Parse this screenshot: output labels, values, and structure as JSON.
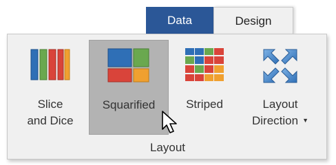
{
  "tabs": {
    "data": "Data",
    "design": "Design"
  },
  "ribbon": {
    "group_label": "Layout",
    "buttons": {
      "slice_line1": "Slice",
      "slice_line2": "and Dice",
      "squarified": "Squarified",
      "striped": "Striped",
      "direction_line1": "Layout",
      "direction_line2": "Direction",
      "direction_arrow": "▼"
    }
  },
  "colors": {
    "tab_active_bg": "#2b5797",
    "panel_bg": "#f0f0f0",
    "selected_button_bg": "#b3b3b3",
    "icon_red": "#d9443a",
    "icon_blue": "#2f6fb6",
    "icon_green": "#6aa84f",
    "icon_orange": "#f0a030"
  },
  "icons": {
    "slice": "slice-and-dice-icon",
    "squarified": "squarified-icon",
    "striped": "striped-icon",
    "direction": "layout-direction-icon",
    "cursor": "mouse-pointer-icon"
  }
}
